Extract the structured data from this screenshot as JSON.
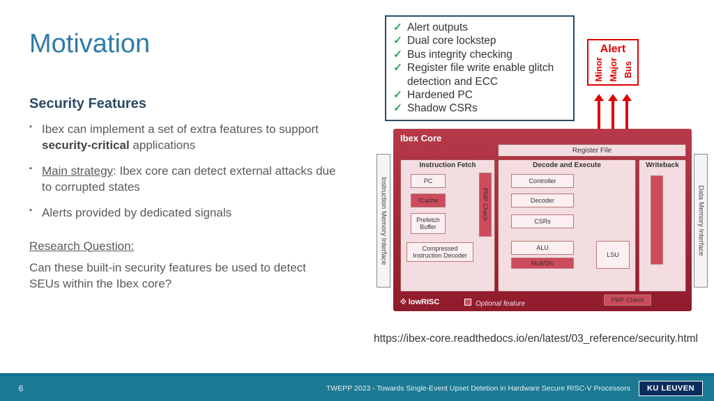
{
  "title": "Motivation",
  "left": {
    "subhead": "Security Features",
    "bullets": [
      {
        "pre": "Ibex can implement a set of extra features to support ",
        "bold": "security-critical",
        "post": " applications"
      },
      {
        "uline": "Main strategy",
        "rest": ": Ibex core can detect external attacks due to corrupted states"
      },
      {
        "plain": "Alerts provided by dedicated signals"
      }
    ],
    "rq_head": "Research Question:",
    "rq_body": "Can these built-in security features be used to detect SEUs within the Ibex core?"
  },
  "checks": [
    "Alert outputs",
    "Dual core lockstep",
    "Bus integrity checking",
    "Register file write enable glitch detection and ECC",
    "Hardened PC",
    "Shadow CSRs"
  ],
  "alert": {
    "title": "Alert",
    "sigs": [
      "Minor",
      "Major",
      "Bus"
    ]
  },
  "diagram": {
    "core_title": "Ibex Core",
    "regfile": "Register File",
    "imi": "Instruction Memory Interface",
    "dmi": "Data Memory Interface",
    "stages": {
      "ifetch": "Instruction Fetch",
      "decexe": "Decode and Execute",
      "wback": "Writeback"
    },
    "blocks": {
      "pc": "PC",
      "icache": "ICache",
      "prefetch": "Prefetch Buffer",
      "cid": "Compressed Instruction Decoder",
      "pmp1": "PMP Check",
      "controller": "Controller",
      "decoder": "Decoder",
      "csrs": "CSRs",
      "alu": "ALU",
      "multdiv": "Mult/Div",
      "lsu": "LSU",
      "pmp2": "PMP Check"
    },
    "lowrisc": "⟐ lowRISC",
    "legend": "Optional feature"
  },
  "url": "https://ibex-core.readthedocs.io/en/latest/03_reference/security.html",
  "footer": {
    "page": "6",
    "conf": "TWEPP 2023 - Towards Single-Event Upset Detetion in Hardware Secure RISC-V Processors",
    "logo": "KU LEUVEN"
  }
}
